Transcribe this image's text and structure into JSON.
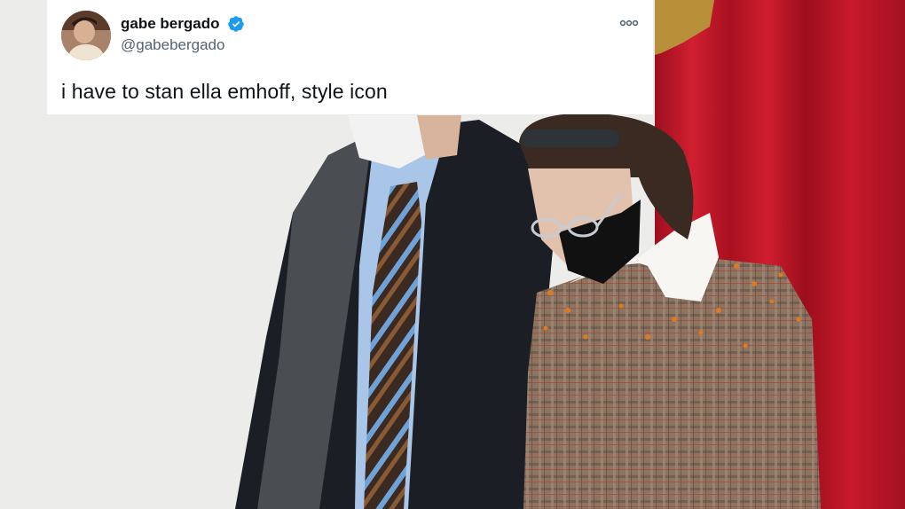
{
  "tweet": {
    "author": {
      "display_name": "gabe bergado",
      "handle": "@gabebergado",
      "verified": true
    },
    "text": "i have to stan ella emhoff, style icon",
    "icons": {
      "verified": "verified-badge-icon",
      "more": "more-options-icon"
    },
    "colors": {
      "card_background": "#ffffff",
      "name": "#0f1419",
      "handle": "#536471",
      "verified": "#1d9bf0"
    }
  },
  "photo": {
    "colors": {
      "background": "#ececea",
      "curtain": "#c0172a",
      "coat": "#1b1e24",
      "plaid": "#8a6f5c",
      "mask": "#111111"
    }
  }
}
